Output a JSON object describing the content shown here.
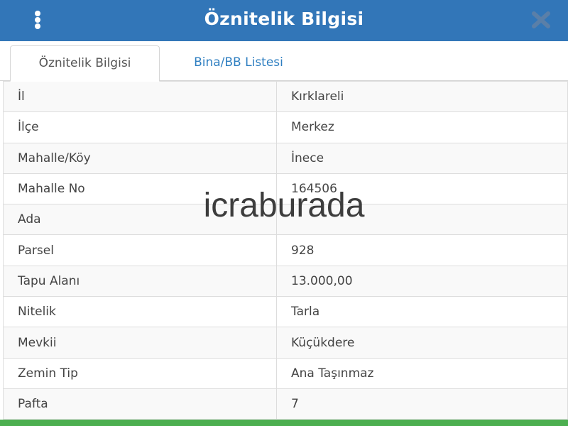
{
  "header": {
    "title": "Öznitelik Bilgisi",
    "menu_icon": "vertical-ellipsis-icon",
    "close_icon": "close-x-icon"
  },
  "tabs": [
    {
      "label": "Öznitelik Bilgisi",
      "active": true
    },
    {
      "label": "Bina/BB Listesi",
      "active": false
    }
  ],
  "rows": [
    {
      "key": "İl",
      "value": "Kırklareli"
    },
    {
      "key": "İlçe",
      "value": "Merkez"
    },
    {
      "key": "Mahalle/Köy",
      "value": "İnece"
    },
    {
      "key": "Mahalle No",
      "value": "164506"
    },
    {
      "key": "Ada",
      "value": ""
    },
    {
      "key": "Parsel",
      "value": "928"
    },
    {
      "key": "Tapu Alanı",
      "value": "13.000,00"
    },
    {
      "key": "Nitelik",
      "value": "Tarla"
    },
    {
      "key": "Mevkii",
      "value": "Küçükdere"
    },
    {
      "key": "Zemin Tip",
      "value": "Ana Taşınmaz"
    },
    {
      "key": "Pafta",
      "value": "7"
    }
  ],
  "watermark": "icraburada",
  "colors": {
    "header": "#3276b8",
    "tab_link": "#2f7fc1",
    "bottom_bar": "#4caf50"
  }
}
